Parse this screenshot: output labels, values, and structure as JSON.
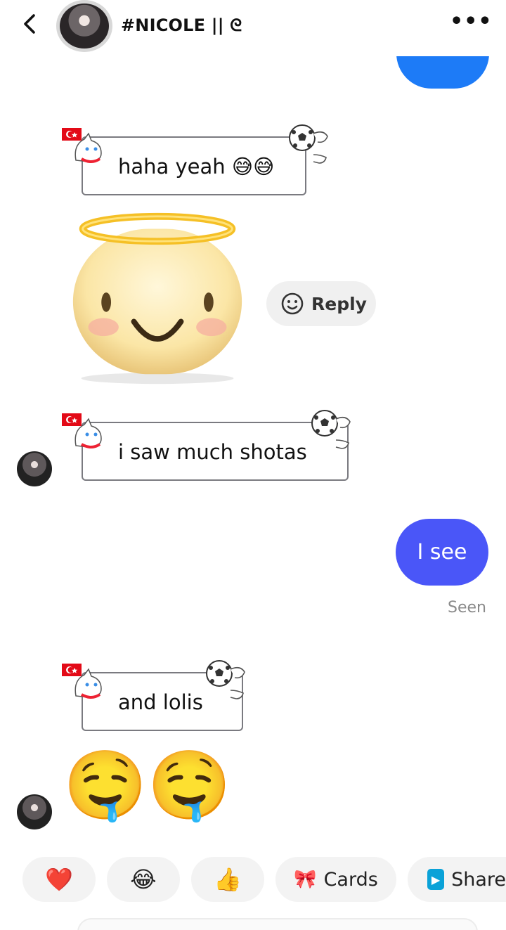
{
  "header": {
    "username": "#NICOLE || ᘓ",
    "back_icon": "chevron-left-icon",
    "more_icon": "more-horizontal-icon",
    "more_glyph": "•••"
  },
  "messages": {
    "m1_text": "haha yeah 😅😅",
    "reply_label": "Reply",
    "m2_text": "i saw much shotas",
    "sent_text": "I see",
    "seen_label": "Seen",
    "m3_text": "and lolis",
    "drool_emoji": "🤤🤤"
  },
  "quick_replies": [
    {
      "icon": "❤️",
      "label": ""
    },
    {
      "icon": "😂",
      "label": ""
    },
    {
      "icon": "👍",
      "label": ""
    },
    {
      "icon": "🎀",
      "label": "Cards"
    },
    {
      "icon": "▶",
      "label": "Share"
    }
  ],
  "colors": {
    "sent_bubble": "#4a56f8",
    "top_bubble": "#1d7bf7",
    "pill_bg": "#f3f3f3"
  }
}
